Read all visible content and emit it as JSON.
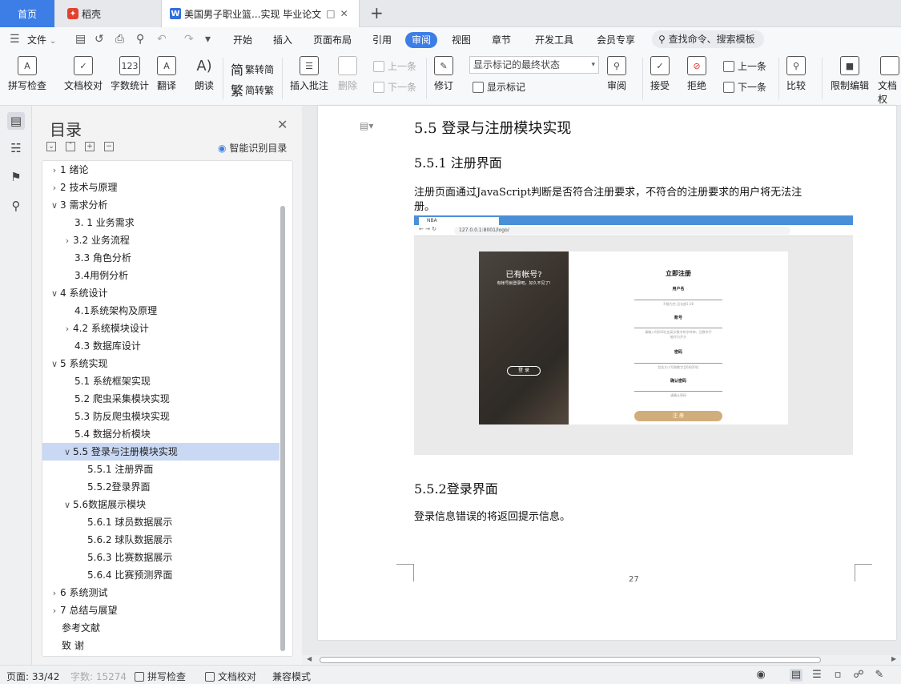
{
  "tabs": {
    "home": "首页",
    "daoke": "稻壳",
    "doc": "美国男子职业篮...实现 毕业论文",
    "add": "+"
  },
  "menu": {
    "file": "文件",
    "items": [
      "开始",
      "插入",
      "页面布局",
      "引用",
      "审阅",
      "视图",
      "章节",
      "开发工具",
      "会员专享"
    ],
    "active": "审阅",
    "search": "查找命令、搜索模板"
  },
  "ribbon": {
    "spell_check": "拼写检查",
    "doc_proof": "文档校对",
    "word_count": "字数统计",
    "translate": "翻译",
    "read_aloud": "朗读",
    "trad_to_simp": "繁转简",
    "simp_to_trad": "简转繁",
    "insert_comment": "插入批注",
    "delete": "删除",
    "prev_comment": "上一条",
    "next_comment": "下一条",
    "revise": "修订",
    "markup_select": "显示标记的最终状态",
    "show_markup": "显示标记",
    "review": "审阅",
    "accept": "接受",
    "reject": "拒绝",
    "prev": "上一条",
    "next": "下一条",
    "compare": "比较",
    "restrict_edit": "限制编辑",
    "doc_rights": "文档权"
  },
  "toc": {
    "title": "目录",
    "smart": "智能识别目录",
    "items": [
      {
        "label": "1 绪论",
        "arrow": ">"
      },
      {
        "label": "2 技术与原理",
        "arrow": ">"
      },
      {
        "label": "3 需求分析",
        "arrow": "v"
      },
      {
        "label": "3. 1 业务需求",
        "arrow": ""
      },
      {
        "label": "3.2 业务流程",
        "arrow": ">"
      },
      {
        "label": "3.3 角色分析",
        "arrow": ""
      },
      {
        "label": "3.4用例分析",
        "arrow": ""
      },
      {
        "label": "4 系统设计",
        "arrow": "v"
      },
      {
        "label": "4.1系统架构及原理",
        "arrow": ""
      },
      {
        "label": "4.2 系统模块设计",
        "arrow": ">"
      },
      {
        "label": "4.3  数据库设计",
        "arrow": ""
      },
      {
        "label": "5 系统实现",
        "arrow": "v"
      },
      {
        "label": "5.1 系统框架实现",
        "arrow": ""
      },
      {
        "label": "5.2 爬虫采集模块实现",
        "arrow": ""
      },
      {
        "label": "5.3 防反爬虫模块实现",
        "arrow": ""
      },
      {
        "label": "5.4 数据分析模块",
        "arrow": ""
      },
      {
        "label": "5.5 登录与注册模块实现",
        "arrow": "v"
      },
      {
        "label": "5.5.1 注册界面",
        "arrow": ""
      },
      {
        "label": "5.5.2登录界面",
        "arrow": ""
      },
      {
        "label": "5.6数据展示模块",
        "arrow": "v"
      },
      {
        "label": "5.6.1 球员数据展示",
        "arrow": ""
      },
      {
        "label": "5.6.2 球队数据展示",
        "arrow": ""
      },
      {
        "label": "5.6.3 比赛数据展示",
        "arrow": ""
      },
      {
        "label": "5.6.4 比赛预测界面",
        "arrow": ""
      },
      {
        "label": "6 系统测试",
        "arrow": ">"
      },
      {
        "label": "7 总结与展望",
        "arrow": ">"
      },
      {
        "label": "参考文献",
        "arrow": ""
      },
      {
        "label": "致  谢",
        "arrow": ""
      }
    ]
  },
  "document": {
    "h2": "5.5 登录与注册模块实现",
    "h3_register": "5.5.1 注册界面",
    "p_register_1": "注册页面通过JavaScript判断是否符合注册要求，不符合的注册要求的用户将无法注",
    "p_register_2": "册。",
    "h3_login": "5.5.2登录界面",
    "p_login": "登录信息错误的将返回提示信息。",
    "page_number": "27"
  },
  "screenshot": {
    "tab": "NBA",
    "url": "127.0.0.1:8001/logo/",
    "left_title": "已有帐号?",
    "left_sub": "有帐号就登录吧，好久不见了!",
    "login_btn": "登 录",
    "form_title": "立即注册",
    "username_label": "用户名",
    "username_hint": "不能为空,且长度1-20",
    "account_label": "账号",
    "account_hint_1": "请输入6到16位由英文数字的字符串，且数字不",
    "account_hint_2": "能作为开头",
    "password_label": "密码",
    "password_hint": "包含大小写和数字且6到20位",
    "confirm_label": "确认密码",
    "confirm_hint": "请确认密码",
    "register_btn": "注 册"
  },
  "status": {
    "page": "页面: 33/42",
    "words": "字数: 15274",
    "spell": "拼写检查",
    "proof": "文档校对",
    "compat": "兼容模式"
  }
}
